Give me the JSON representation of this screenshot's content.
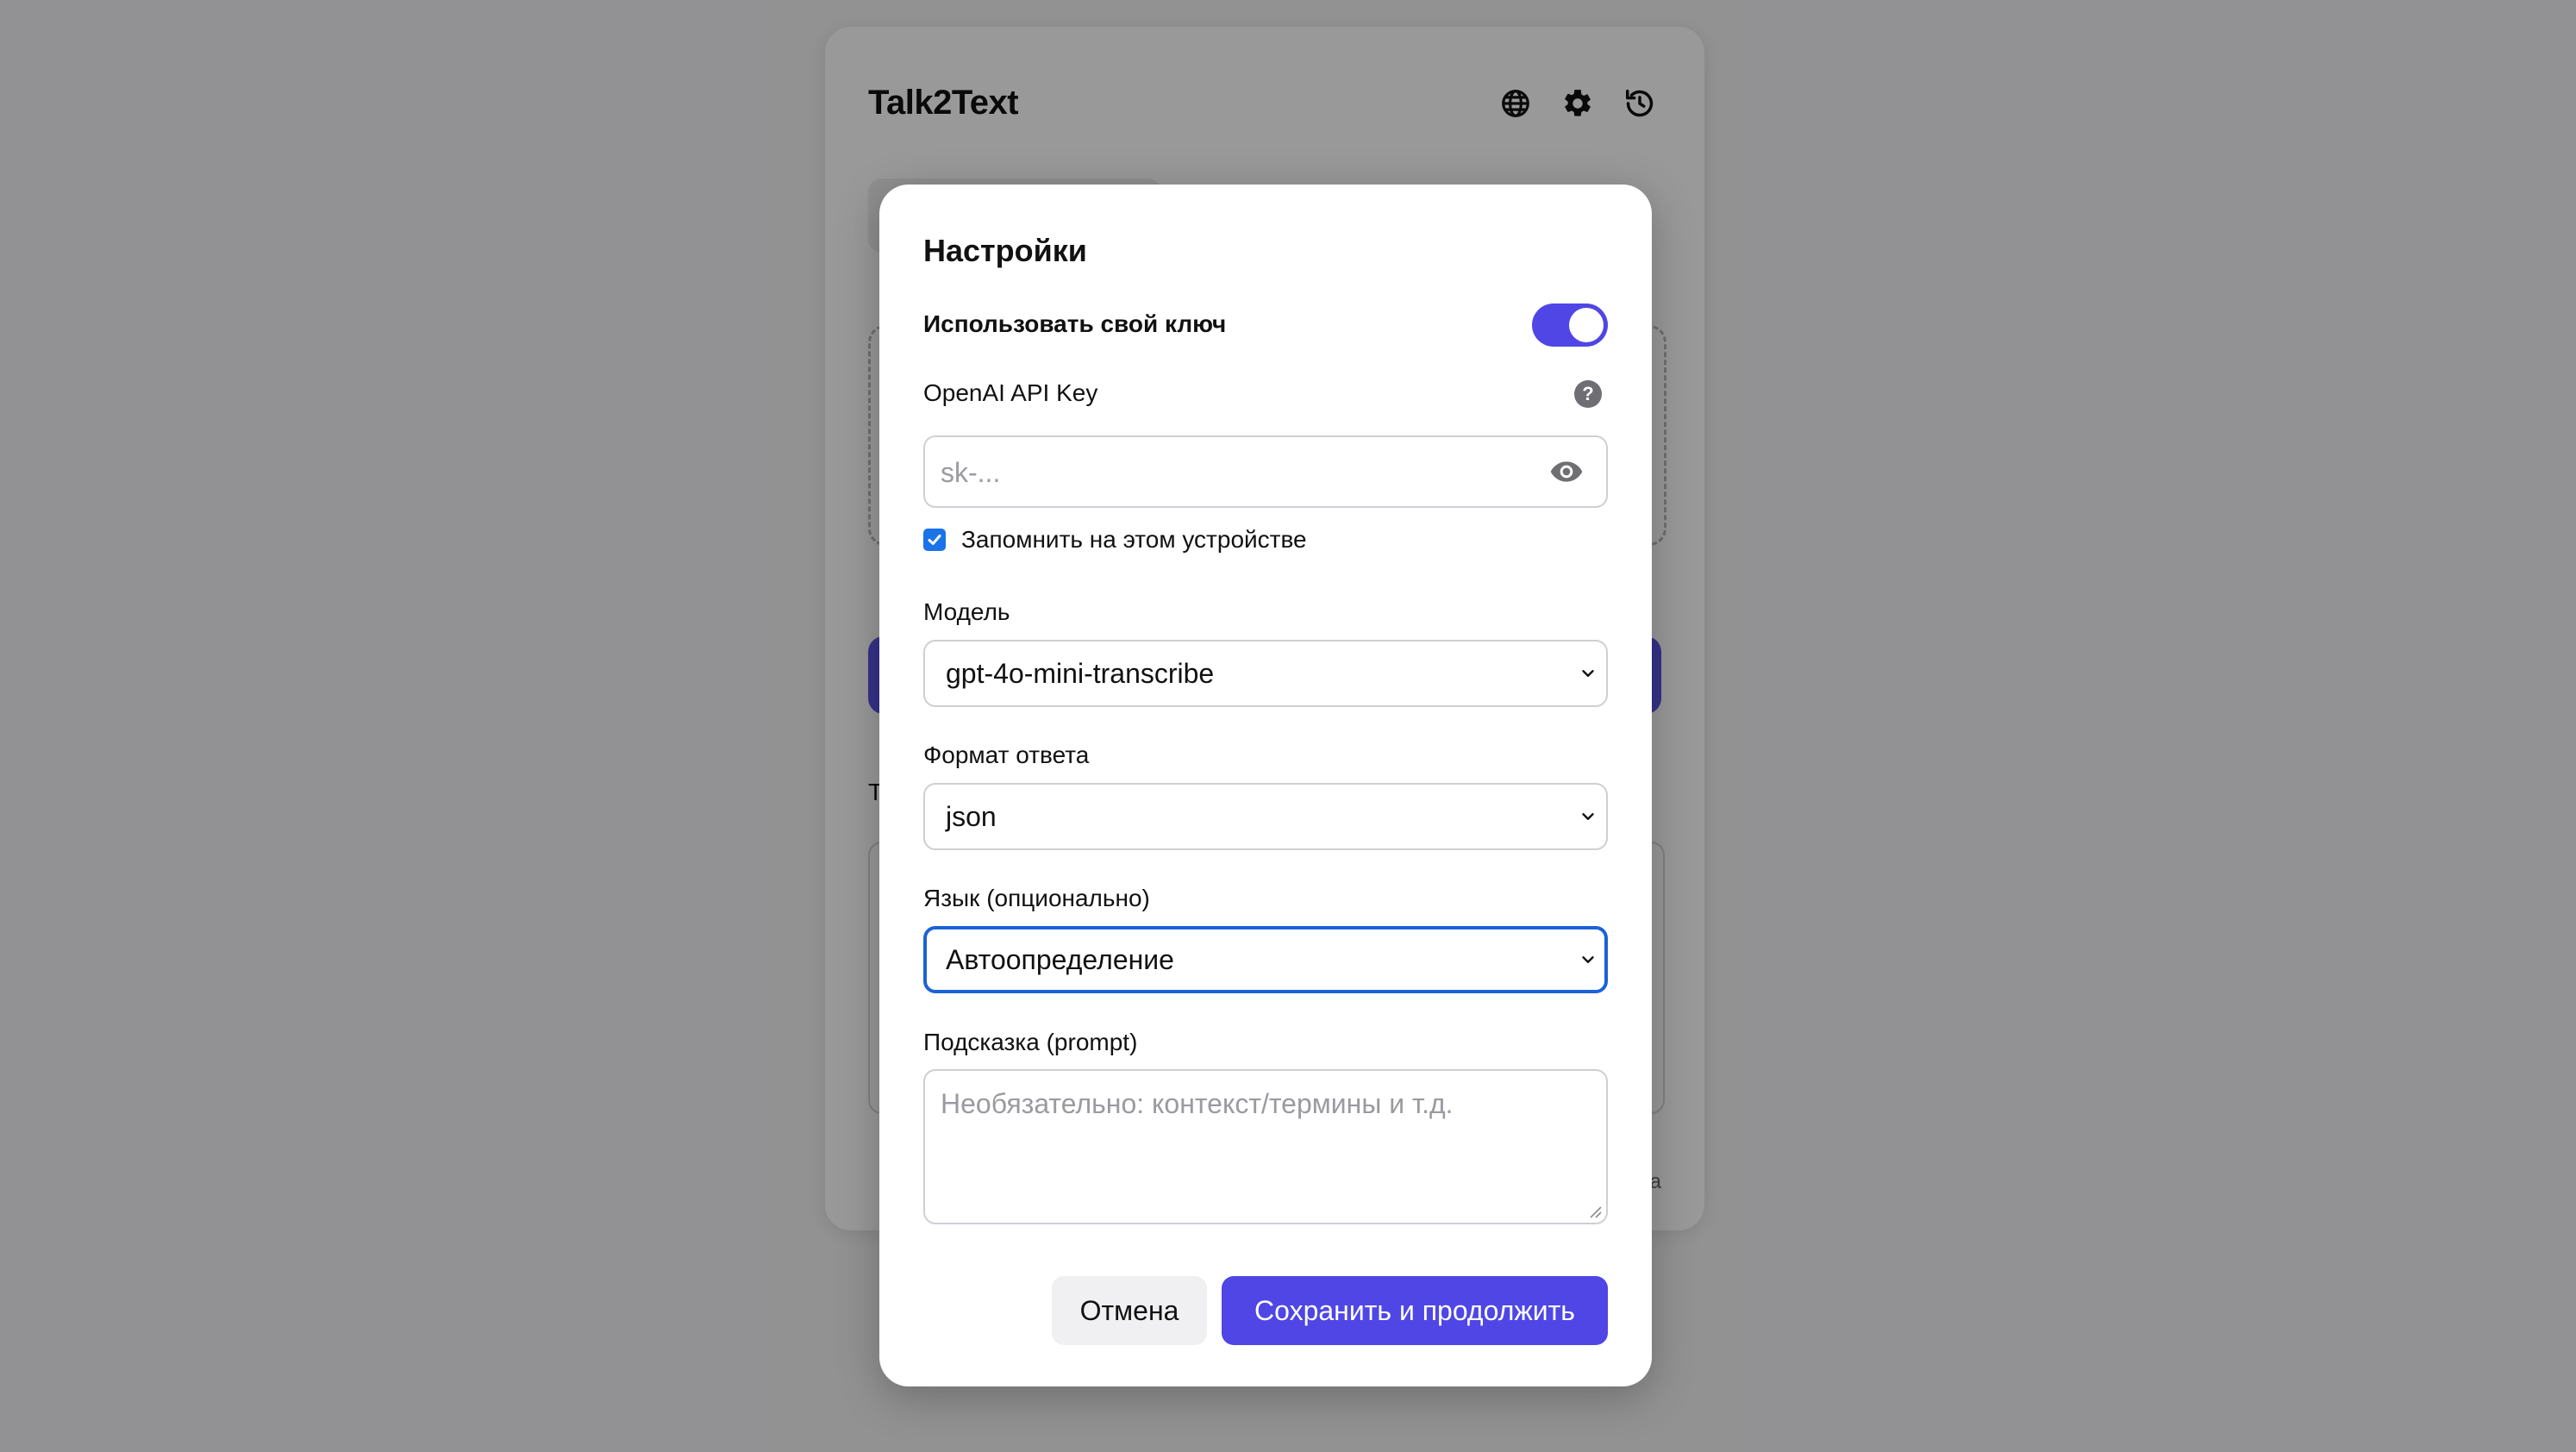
{
  "app": {
    "title": "Talk2Text",
    "bg_label": "Т",
    "bg_footnote": "а"
  },
  "header": {
    "icons": [
      "globe-icon",
      "gear-icon",
      "history-icon"
    ]
  },
  "settings_modal": {
    "title": "Настройки",
    "own_key_label": "Использовать свой ключ",
    "own_key_enabled": true,
    "api_key_label": "OpenAI API Key",
    "api_key_help": "?",
    "api_key_value": "",
    "api_key_placeholder": "sk-...",
    "remember_label": "Запомнить на этом устройстве",
    "remember_checked": true,
    "model_label": "Модель",
    "model_value": "gpt-4o-mini-transcribe",
    "format_label": "Формат ответа",
    "format_value": "json",
    "language_label": "Язык (опционально)",
    "language_value": "Автоопределение",
    "prompt_label": "Подсказка (prompt)",
    "prompt_value": "",
    "prompt_placeholder": "Необязательно: контекст/термины и т.д.",
    "cancel_label": "Отмена",
    "save_label": "Сохранить и продолжить"
  },
  "colors": {
    "accent": "#4f46e5",
    "focus_border": "#1a62d6",
    "checkbox": "#1a73e8",
    "overlay": "rgba(0,0,0,0.40)"
  }
}
